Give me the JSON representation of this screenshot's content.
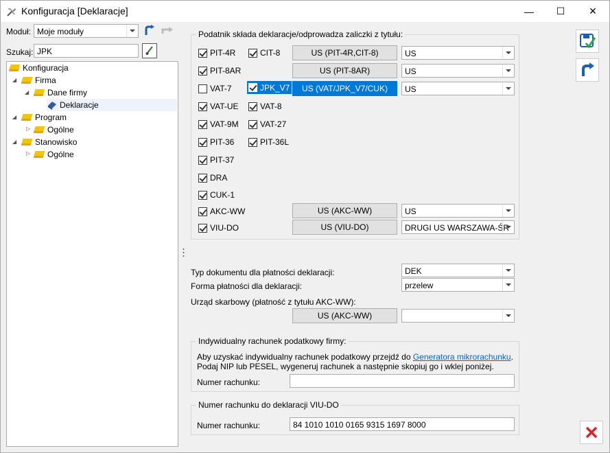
{
  "window": {
    "title": "Konfiguracja [Deklaracje]",
    "min_glyph": "—",
    "max_glyph": "☐",
    "close_glyph": "✕"
  },
  "left": {
    "modul_label": "Moduł:",
    "modul_value": "Moje moduły",
    "search_label": "Szukaj:",
    "search_value": "JPK"
  },
  "tree": {
    "items": [
      {
        "label": "Konfiguracja"
      },
      {
        "label": "Firma"
      },
      {
        "label": "Dane firmy"
      },
      {
        "label": "Deklaracje"
      },
      {
        "label": "Program"
      },
      {
        "label": "Ogólne"
      },
      {
        "label": "Stanowisko"
      },
      {
        "label": "Ogólne"
      }
    ]
  },
  "podatnik": {
    "title": "Podatnik składa deklaracje/odprowadza zaliczki z tytułu:",
    "col1": [
      {
        "label": "PIT-4R",
        "checked": true
      },
      {
        "label": "PIT-8AR",
        "checked": true
      },
      {
        "label": "VAT-7",
        "checked": false
      },
      {
        "label": "VAT-UE",
        "checked": true
      },
      {
        "label": "VAT-9M",
        "checked": true
      },
      {
        "label": "PIT-36",
        "checked": true
      },
      {
        "label": "PIT-37",
        "checked": true
      },
      {
        "label": "DRA",
        "checked": true
      },
      {
        "label": "CUK-1",
        "checked": true
      },
      {
        "label": "AKC-WW",
        "checked": true
      },
      {
        "label": "VIU-DO",
        "checked": true
      }
    ],
    "col2": [
      {
        "label": "CIT-8",
        "checked": true
      },
      {
        "label": "JPK_V7",
        "checked": true
      },
      {
        "label": "VAT-8",
        "checked": true
      },
      {
        "label": "VAT-27",
        "checked": true
      },
      {
        "label": "PIT-36L",
        "checked": true
      }
    ],
    "us_buttons": [
      {
        "label": "US (PIT-4R,CIT-8)",
        "value": "US"
      },
      {
        "label": "US (PIT-8AR)",
        "value": "US"
      },
      {
        "label": "US (VAT/JPK_V7/CUK)",
        "value": "US"
      },
      {
        "label": "US (AKC-WW)",
        "value": "US"
      },
      {
        "label": "US (VIU-DO)",
        "value": "DRUGI US WARSZAWA-ŚR"
      }
    ]
  },
  "platnosc": {
    "typ_label": "Typ dokumentu dla płatności deklaracji:",
    "typ_value": "DEK",
    "forma_label": "Forma płatności dla deklaracji:",
    "forma_value": "przelew",
    "urzad_label": "Urząd skarbowy (płatność z tytułu AKC-WW):",
    "urzad_button": "US (AKC-WW)",
    "urzad_value": ""
  },
  "irp": {
    "title": "Indywidualny rachunek podatkowy firmy:",
    "line1_pre": "Aby uzyskać indywidualny rachunek podatkowy przejdź do ",
    "line1_link": "Generatora mikrorachunku",
    "line1_post": ".",
    "line2": "Podaj NIP lub PESEL, wygeneruj rachunek a następnie skopiuj go i wklej poniżej.",
    "nr_label": "Numer rachunku:",
    "nr_value": ""
  },
  "viu": {
    "title": "Numer rachunku do deklaracji VIU-DO",
    "nr_label": "Numer rachunku:",
    "nr_value": "84 1010 1010 0165 9315 1697 8000"
  },
  "colors": {
    "accent": "#0078d7",
    "link": "#0066cc",
    "close_red": "#d9232a"
  }
}
